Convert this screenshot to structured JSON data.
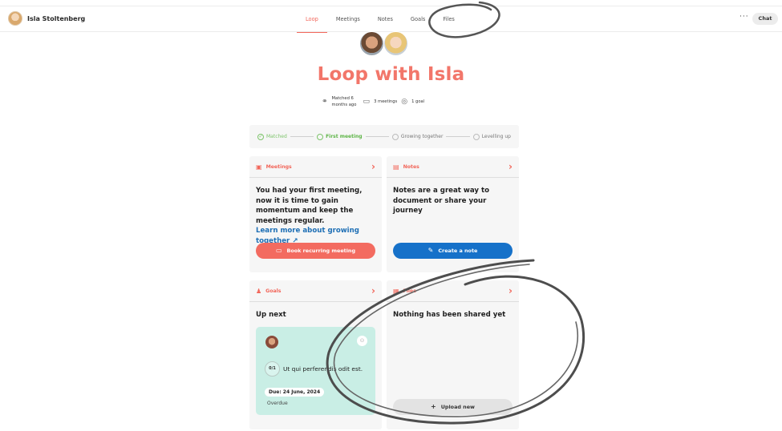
{
  "user": {
    "name": "Isla Stoltenberg"
  },
  "tabs": [
    {
      "label": "Loop"
    },
    {
      "label": "Meetings"
    },
    {
      "label": "Notes"
    },
    {
      "label": "Goals"
    },
    {
      "label": "Files"
    }
  ],
  "actions": {
    "more": "···",
    "chat": "Chat"
  },
  "header": {
    "title": "Loop with Isla",
    "matched": "Matched 6 months ago",
    "meetings": "3 meetings",
    "goals": "1 goal"
  },
  "progress": {
    "steps": [
      {
        "label": "Matched",
        "state": "done"
      },
      {
        "label": "First meeting",
        "state": "current"
      },
      {
        "label": "Growing together",
        "state": "todo"
      },
      {
        "label": "Levelling up",
        "state": "todo"
      }
    ]
  },
  "meetings_card": {
    "title": "Meetings",
    "body": "You had your first meeting, now it is time to gain momentum and keep the meetings regular.",
    "link": "Learn more about growing together ↗",
    "button": "Book recurring meeting"
  },
  "notes_card": {
    "title": "Notes",
    "body": "Notes are a great way to document or share your journey",
    "button": "Create a note"
  },
  "goals_card": {
    "title": "Goals",
    "up_next": "Up next",
    "goal": {
      "progress": "0/1",
      "text": "Ut qui perferendis odit est.",
      "due": "Due: 24 June, 2024",
      "status": "Overdue"
    }
  },
  "files_card": {
    "title": "Files",
    "body": "Nothing has been shared yet",
    "button": "Upload new"
  },
  "colors": {
    "accent": "#f2665a",
    "blue": "#1671c9",
    "green": "#7dc46b",
    "goal_bg": "#c9eee5"
  }
}
